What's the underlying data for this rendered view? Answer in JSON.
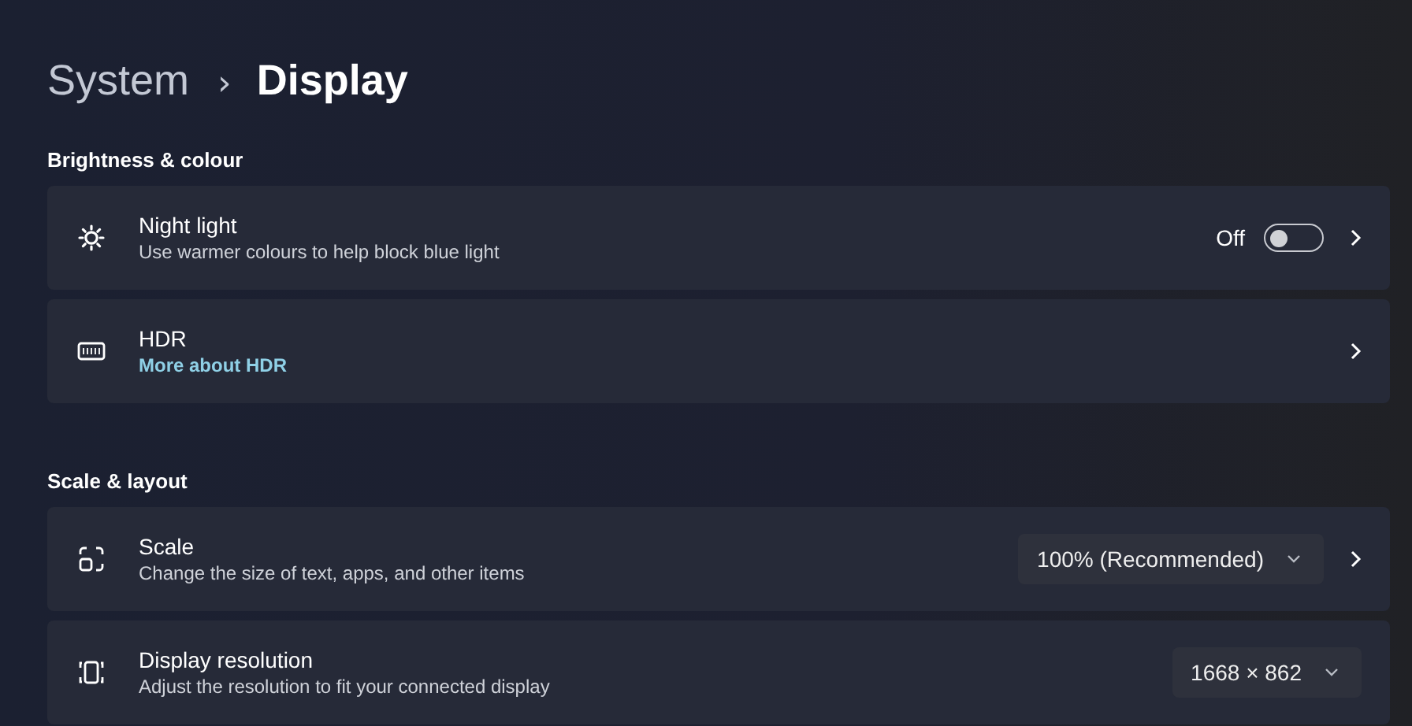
{
  "breadcrumb": {
    "parent": "System",
    "separator": "›",
    "current": "Display"
  },
  "sections": [
    {
      "title": "Brightness & colour",
      "rows": [
        {
          "kind": "toggle",
          "title": "Night light",
          "subtitle": "Use warmer colours to help block blue light",
          "toggle": {
            "label": "Off",
            "on": false
          },
          "chevron": true
        },
        {
          "kind": "link",
          "title": "HDR",
          "link": "More about HDR",
          "chevron": true
        }
      ]
    },
    {
      "title": "Scale & layout",
      "rows": [
        {
          "kind": "dropdown",
          "title": "Scale",
          "subtitle": "Change the size of text, apps, and other items",
          "dropdown": {
            "value": "100% (Recommended)"
          },
          "chevron": true
        },
        {
          "kind": "dropdown",
          "title": "Display resolution",
          "subtitle": "Adjust the resolution to fit your connected display",
          "dropdown": {
            "value": "1668 × 862"
          },
          "chevron": false
        }
      ]
    }
  ]
}
